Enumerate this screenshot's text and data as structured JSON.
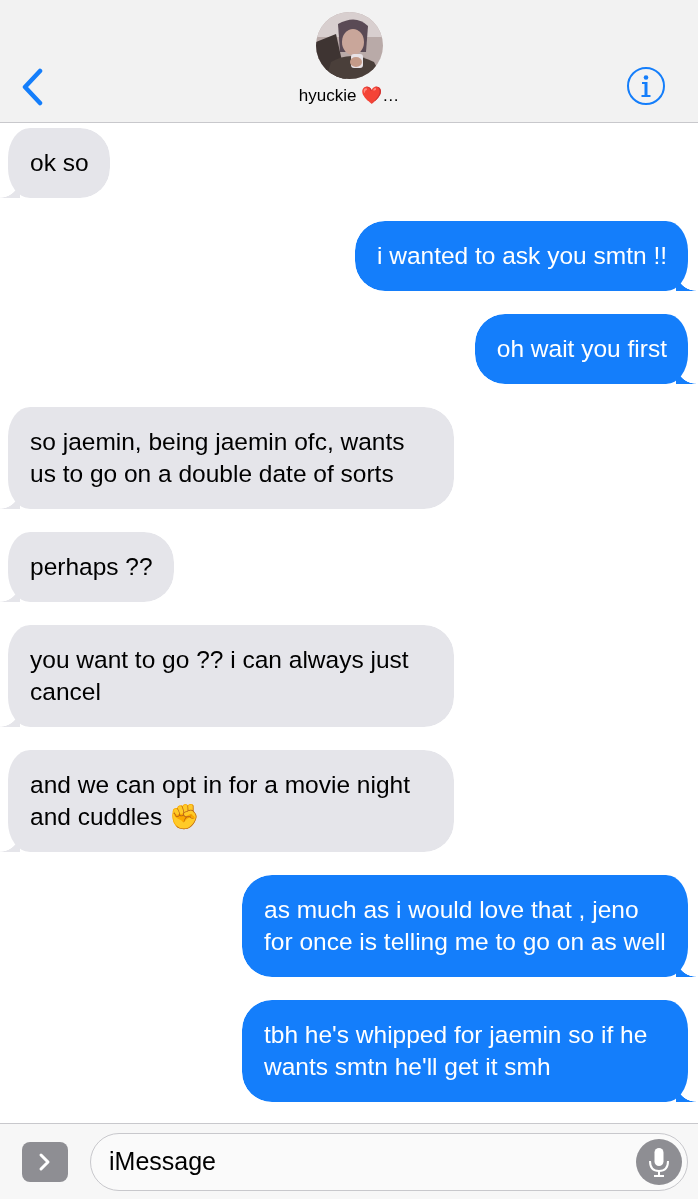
{
  "header": {
    "contact_name": "hyuckie ❤️…"
  },
  "messages": [
    {
      "text": "ok so",
      "kind": "received"
    },
    {
      "text": "i wanted to ask you smtn !!",
      "kind": "sent"
    },
    {
      "text": "oh wait you first",
      "kind": "sent"
    },
    {
      "text": "so jaemin, being jaemin ofc, wants us to go on a double date of sorts",
      "kind": "received"
    },
    {
      "text": "perhaps ??",
      "kind": "received"
    },
    {
      "text": "you want to go ?? i can always just cancel",
      "kind": "received"
    },
    {
      "text": "and we can opt in for a movie night and cuddles ✊",
      "kind": "received"
    },
    {
      "text": "as much as i would love that , jeno for once is telling me to go on as well",
      "kind": "sent"
    },
    {
      "text": "tbh he's whipped for jaemin so if he wants smtn he'll get it smh",
      "kind": "sent"
    }
  ],
  "composer": {
    "placeholder": "iMessage"
  }
}
